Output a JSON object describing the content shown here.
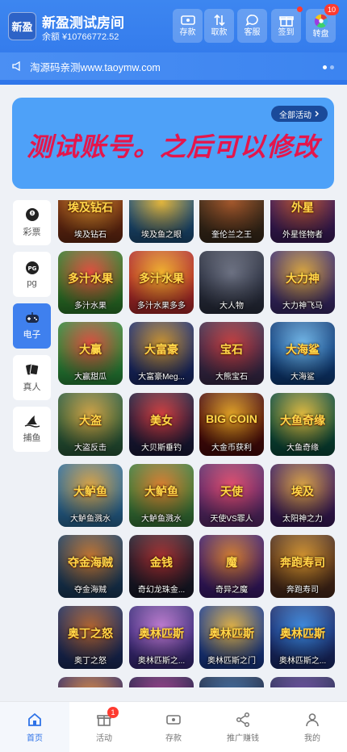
{
  "header": {
    "logo_text": "新盈",
    "site_name": "新盈测试房间",
    "balance": "余额 ¥10766772.52",
    "buttons": [
      {
        "label": "存款",
        "icon": "deposit-icon"
      },
      {
        "label": "取款",
        "icon": "withdraw-icon"
      },
      {
        "label": "客服",
        "icon": "chat-icon"
      },
      {
        "label": "签到",
        "icon": "gift-icon"
      },
      {
        "label": "转盘",
        "icon": "wheel-icon",
        "badge": "10"
      }
    ]
  },
  "marquee": {
    "text": "淘源码亲测www.taoymw.com"
  },
  "banner": {
    "text": "测试账号。之后可以修改",
    "all_activities": "全部活动"
  },
  "categories": [
    {
      "label": "彩票",
      "icon": "lottery-ball-icon"
    },
    {
      "label": "pg",
      "icon": "pg-logo-icon"
    },
    {
      "label": "电子",
      "icon": "gamepad-icon",
      "active": true
    },
    {
      "label": "真人",
      "icon": "cards-icon"
    },
    {
      "label": "捕鱼",
      "icon": "shark-fin-icon"
    }
  ],
  "games": [
    {
      "name": "埃及钻石",
      "title": "埃及钻石",
      "c1": "#6b2a12",
      "c2": "#d18a2a"
    },
    {
      "name": "埃及鱼之眼",
      "title": "",
      "c1": "#1d4f7a",
      "c2": "#e0b33a"
    },
    {
      "name": "奎伦兰之王",
      "title": "",
      "c1": "#3a2a1a",
      "c2": "#a0552a"
    },
    {
      "name": "外星怪物者",
      "title": "外星",
      "c1": "#3b1b5a",
      "c2": "#b7542c"
    },
    {
      "name": "多汁水果",
      "title": "多汁水果",
      "c1": "#2e7a2a",
      "c2": "#e14a3a"
    },
    {
      "name": "多汁水果多多",
      "title": "多汁水果",
      "c1": "#b02a2a",
      "c2": "#f0b02a"
    },
    {
      "name": "大人物",
      "title": "",
      "c1": "#2a2f3f",
      "c2": "#6a6f80"
    },
    {
      "name": "大力神飞马",
      "title": "大力神",
      "c1": "#3a2a6a",
      "c2": "#d8a43a"
    },
    {
      "name": "大赢甜瓜",
      "title": "大赢",
      "c1": "#2a8a3a",
      "c2": "#d94a3a"
    },
    {
      "name": "大富豪Meg...",
      "title": "大富豪",
      "c1": "#1a2a6a",
      "c2": "#c8902a"
    },
    {
      "name": "大熊宝石",
      "title": "宝石",
      "c1": "#3a2a4a",
      "c2": "#c23a3a"
    },
    {
      "name": "大海鲨",
      "title": "大海鲨",
      "c1": "#0e3c7a",
      "c2": "#6fb6e8"
    },
    {
      "name": "大盗反击",
      "title": "大盗",
      "c1": "#2a5a3a",
      "c2": "#d0a040"
    },
    {
      "name": "大贝斯垂钓",
      "title": "美女",
      "c1": "#1a1a3a",
      "c2": "#d03a3a"
    },
    {
      "name": "大金币获利",
      "title": "BIG COIN",
      "c1": "#4a0a0a",
      "c2": "#e0a020"
    },
    {
      "name": "大鱼奇缘",
      "title": "大鱼奇缘",
      "c1": "#0a4a3a",
      "c2": "#e0b83a"
    },
    {
      "name": "大鲈鱼溅水",
      "title": "大鲈鱼",
      "c1": "#2a6a9a",
      "c2": "#d8a040"
    },
    {
      "name": "大鲈鱼溅水",
      "title": "大鲈鱼",
      "c1": "#3a7a3a",
      "c2": "#d87a2a"
    },
    {
      "name": "天使VS罪人",
      "title": "天使",
      "c1": "#5a2a6a",
      "c2": "#e04a6a"
    },
    {
      "name": "太阳神之力",
      "title": "埃及",
      "c1": "#3a1a5a",
      "c2": "#d8a040"
    },
    {
      "name": "夺金海贼",
      "title": "夺金海贼",
      "c1": "#1a3a5a",
      "c2": "#c0702a"
    },
    {
      "name": "奇幻龙珠金...",
      "title": "金钱",
      "c1": "#1a1a2a",
      "c2": "#a02a2a"
    },
    {
      "name": "奇异之魔",
      "title": "魔",
      "c1": "#3a1a6a",
      "c2": "#d07a2a"
    },
    {
      "name": "奔跑寿司",
      "title": "奔跑寿司",
      "c1": "#4a2a1a",
      "c2": "#d0902a"
    },
    {
      "name": "奥丁之怒",
      "title": "奥丁之怒",
      "c1": "#1a2a5a",
      "c2": "#b0602a"
    },
    {
      "name": "奥林匹斯之...",
      "title": "奥林匹斯",
      "c1": "#3a2a7a",
      "c2": "#c07ad0"
    },
    {
      "name": "奥林匹斯之门",
      "title": "奥林匹斯",
      "c1": "#1a3a8a",
      "c2": "#e0b040"
    },
    {
      "name": "奥林匹斯之...",
      "title": "奥林匹斯",
      "c1": "#1a2a6a",
      "c2": "#3a8ae0"
    },
    {
      "name": "",
      "title": "",
      "c1": "#3a2a5a",
      "c2": "#e08a3a"
    },
    {
      "name": "",
      "title": "",
      "c1": "#2a1a4a",
      "c2": "#a03a8a"
    },
    {
      "name": "",
      "title": "",
      "c1": "#1a2a4a",
      "c2": "#3a6aa0"
    },
    {
      "name": "",
      "title": "",
      "c1": "#2a2a5a",
      "c2": "#6a4aa0"
    }
  ],
  "nav": [
    {
      "label": "首页",
      "icon": "home-icon",
      "active": true
    },
    {
      "label": "活动",
      "icon": "gift-icon",
      "badge": "1"
    },
    {
      "label": "存款",
      "icon": "deposit-icon"
    },
    {
      "label": "推广赚钱",
      "icon": "share-icon"
    },
    {
      "label": "我的",
      "icon": "user-icon"
    }
  ],
  "colors": {
    "primary": "#3f80ee",
    "banner": "#4ea1f8",
    "banner_text": "#e4164c",
    "badge": "#ff3b30"
  }
}
